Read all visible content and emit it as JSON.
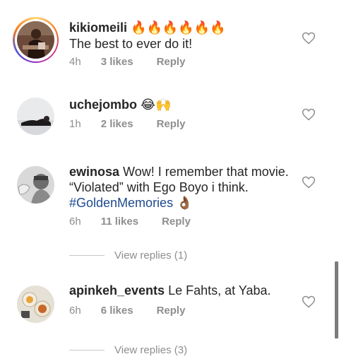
{
  "comments": [
    {
      "username": "kikiomeili",
      "emoji": "🔥🔥🔥🔥🔥🔥",
      "text": "The best to ever do it!",
      "time": "4h",
      "likes": "3 likes",
      "reply": "Reply"
    },
    {
      "username": "uchejombo",
      "emoji": "😂🙌",
      "text": "",
      "time": "1h",
      "likes": "2 likes",
      "reply": "Reply"
    },
    {
      "username": "ewinosa",
      "text": "Wow! I remember that movie. “Violated” with Ego Boyo i think.",
      "hashtag": "#GoldenMemories",
      "emoji": "👌🏾",
      "time": "6h",
      "likes": "11 likes",
      "reply": "Reply",
      "view_replies": "View replies (1)"
    },
    {
      "username": "apinkeh_events",
      "text": "Le Fahts, at Yaba.",
      "time": "6h",
      "likes": "6 likes",
      "reply": "Reply",
      "view_replies": "View replies (3)"
    }
  ],
  "icons": {
    "heart": "heart-outline-icon"
  },
  "colors": {
    "text": "#262626",
    "meta": "#8e8e8e",
    "hashtag": "#1d4a8f"
  }
}
